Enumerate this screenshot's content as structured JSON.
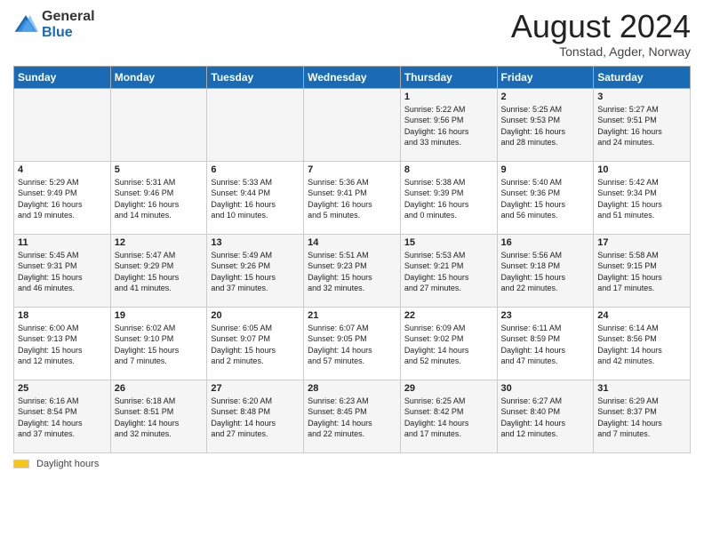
{
  "header": {
    "logo_general": "General",
    "logo_blue": "Blue",
    "month_year": "August 2024",
    "location": "Tonstad, Agder, Norway"
  },
  "days_of_week": [
    "Sunday",
    "Monday",
    "Tuesday",
    "Wednesday",
    "Thursday",
    "Friday",
    "Saturday"
  ],
  "weeks": [
    [
      {
        "day": "",
        "info": ""
      },
      {
        "day": "",
        "info": ""
      },
      {
        "day": "",
        "info": ""
      },
      {
        "day": "",
        "info": ""
      },
      {
        "day": "1",
        "info": "Sunrise: 5:22 AM\nSunset: 9:56 PM\nDaylight: 16 hours\nand 33 minutes."
      },
      {
        "day": "2",
        "info": "Sunrise: 5:25 AM\nSunset: 9:53 PM\nDaylight: 16 hours\nand 28 minutes."
      },
      {
        "day": "3",
        "info": "Sunrise: 5:27 AM\nSunset: 9:51 PM\nDaylight: 16 hours\nand 24 minutes."
      }
    ],
    [
      {
        "day": "4",
        "info": "Sunrise: 5:29 AM\nSunset: 9:49 PM\nDaylight: 16 hours\nand 19 minutes."
      },
      {
        "day": "5",
        "info": "Sunrise: 5:31 AM\nSunset: 9:46 PM\nDaylight: 16 hours\nand 14 minutes."
      },
      {
        "day": "6",
        "info": "Sunrise: 5:33 AM\nSunset: 9:44 PM\nDaylight: 16 hours\nand 10 minutes."
      },
      {
        "day": "7",
        "info": "Sunrise: 5:36 AM\nSunset: 9:41 PM\nDaylight: 16 hours\nand 5 minutes."
      },
      {
        "day": "8",
        "info": "Sunrise: 5:38 AM\nSunset: 9:39 PM\nDaylight: 16 hours\nand 0 minutes."
      },
      {
        "day": "9",
        "info": "Sunrise: 5:40 AM\nSunset: 9:36 PM\nDaylight: 15 hours\nand 56 minutes."
      },
      {
        "day": "10",
        "info": "Sunrise: 5:42 AM\nSunset: 9:34 PM\nDaylight: 15 hours\nand 51 minutes."
      }
    ],
    [
      {
        "day": "11",
        "info": "Sunrise: 5:45 AM\nSunset: 9:31 PM\nDaylight: 15 hours\nand 46 minutes."
      },
      {
        "day": "12",
        "info": "Sunrise: 5:47 AM\nSunset: 9:29 PM\nDaylight: 15 hours\nand 41 minutes."
      },
      {
        "day": "13",
        "info": "Sunrise: 5:49 AM\nSunset: 9:26 PM\nDaylight: 15 hours\nand 37 minutes."
      },
      {
        "day": "14",
        "info": "Sunrise: 5:51 AM\nSunset: 9:23 PM\nDaylight: 15 hours\nand 32 minutes."
      },
      {
        "day": "15",
        "info": "Sunrise: 5:53 AM\nSunset: 9:21 PM\nDaylight: 15 hours\nand 27 minutes."
      },
      {
        "day": "16",
        "info": "Sunrise: 5:56 AM\nSunset: 9:18 PM\nDaylight: 15 hours\nand 22 minutes."
      },
      {
        "day": "17",
        "info": "Sunrise: 5:58 AM\nSunset: 9:15 PM\nDaylight: 15 hours\nand 17 minutes."
      }
    ],
    [
      {
        "day": "18",
        "info": "Sunrise: 6:00 AM\nSunset: 9:13 PM\nDaylight: 15 hours\nand 12 minutes."
      },
      {
        "day": "19",
        "info": "Sunrise: 6:02 AM\nSunset: 9:10 PM\nDaylight: 15 hours\nand 7 minutes."
      },
      {
        "day": "20",
        "info": "Sunrise: 6:05 AM\nSunset: 9:07 PM\nDaylight: 15 hours\nand 2 minutes."
      },
      {
        "day": "21",
        "info": "Sunrise: 6:07 AM\nSunset: 9:05 PM\nDaylight: 14 hours\nand 57 minutes."
      },
      {
        "day": "22",
        "info": "Sunrise: 6:09 AM\nSunset: 9:02 PM\nDaylight: 14 hours\nand 52 minutes."
      },
      {
        "day": "23",
        "info": "Sunrise: 6:11 AM\nSunset: 8:59 PM\nDaylight: 14 hours\nand 47 minutes."
      },
      {
        "day": "24",
        "info": "Sunrise: 6:14 AM\nSunset: 8:56 PM\nDaylight: 14 hours\nand 42 minutes."
      }
    ],
    [
      {
        "day": "25",
        "info": "Sunrise: 6:16 AM\nSunset: 8:54 PM\nDaylight: 14 hours\nand 37 minutes."
      },
      {
        "day": "26",
        "info": "Sunrise: 6:18 AM\nSunset: 8:51 PM\nDaylight: 14 hours\nand 32 minutes."
      },
      {
        "day": "27",
        "info": "Sunrise: 6:20 AM\nSunset: 8:48 PM\nDaylight: 14 hours\nand 27 minutes."
      },
      {
        "day": "28",
        "info": "Sunrise: 6:23 AM\nSunset: 8:45 PM\nDaylight: 14 hours\nand 22 minutes."
      },
      {
        "day": "29",
        "info": "Sunrise: 6:25 AM\nSunset: 8:42 PM\nDaylight: 14 hours\nand 17 minutes."
      },
      {
        "day": "30",
        "info": "Sunrise: 6:27 AM\nSunset: 8:40 PM\nDaylight: 14 hours\nand 12 minutes."
      },
      {
        "day": "31",
        "info": "Sunrise: 6:29 AM\nSunset: 8:37 PM\nDaylight: 14 hours\nand 7 minutes."
      }
    ]
  ],
  "footer": {
    "label": "Daylight hours"
  }
}
